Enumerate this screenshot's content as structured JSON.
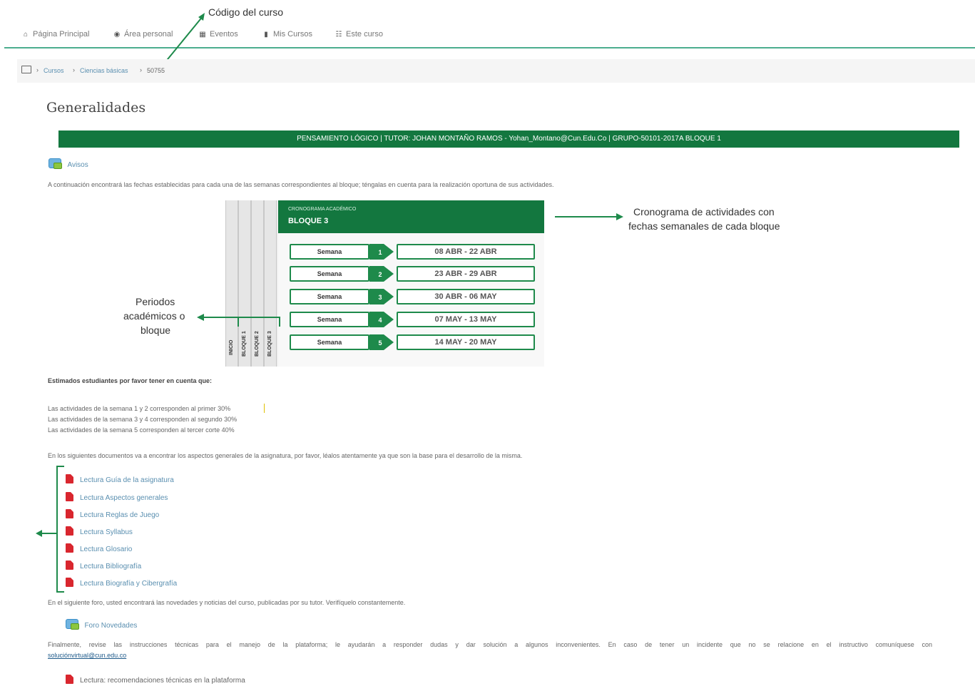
{
  "annotations": {
    "course_code": "Código del curso",
    "schedule_line1": "Cronograma de actividades con",
    "schedule_line2": "fechas semanales de cada bloque",
    "periods_line1": "Periodos",
    "periods_line2": "académicos o",
    "periods_line3": "bloque"
  },
  "nav": {
    "items": [
      {
        "label": "Página Principal",
        "icon": "home-icon"
      },
      {
        "label": "Área personal",
        "icon": "dashboard-icon"
      },
      {
        "label": "Eventos",
        "icon": "calendar-icon"
      },
      {
        "label": "Mis Cursos",
        "icon": "briefcase-icon"
      },
      {
        "label": "Este curso",
        "icon": "sitemap-icon"
      }
    ]
  },
  "breadcrumb": {
    "items": [
      "Cursos",
      "Ciencias básicas",
      "50755"
    ],
    "separator": "›"
  },
  "page": {
    "title": "Generalidades",
    "banner": "PENSAMIENTO LÓGICO | TUTOR: JOHAN MONTAÑO RAMOS - Yohan_Montano@Cun.Edu.Co | GRUPO-50101-2017A BLOQUE 1",
    "avisos_label": "Avisos",
    "intro": "A continuación encontrará las fechas establecidas para cada una de las semanas correspondientes al bloque; téngalas en cuenta para la realización oportuna de sus actividades."
  },
  "schedule": {
    "header_small": "CRONOGRAMA ACADÉMICO",
    "header_title": "BLOQUE 3",
    "side_labels": [
      "INICIO",
      "BLOQUE 1",
      "BLOQUE 2",
      "BLOQUE 3"
    ],
    "weeks": [
      {
        "label": "Semana",
        "num": "1",
        "dates": "08 ABR - 22 ABR"
      },
      {
        "label": "Semana",
        "num": "2",
        "dates": "23 ABR - 29 ABR"
      },
      {
        "label": "Semana",
        "num": "3",
        "dates": "30 ABR - 06 MAY"
      },
      {
        "label": "Semana",
        "num": "4",
        "dates": "07 MAY - 13 MAY"
      },
      {
        "label": "Semana",
        "num": "5",
        "dates": "14 MAY - 20 MAY"
      }
    ]
  },
  "notes": {
    "heading": "Estimados estudiantes por favor tener en cuenta que:",
    "lines": [
      "Las actividades de la semana 1 y 2 corresponden al primer 30%",
      "Las actividades de la semana 3 y 4 corresponden al segundo 30%",
      "Las actividades de la semana 5 corresponden al tercer corte 40%"
    ],
    "docs_intro": "En los siguientes documentos va a encontrar los aspectos generales de la asignatura, por favor, léalos atentamente ya que son la base para el desarrollo de la misma."
  },
  "documents": [
    "Lectura Guía de la asignatura",
    "Lectura Aspectos generales",
    "Lectura Reglas de Juego",
    "Lectura Syllabus",
    "Lectura Glosario",
    "Lectura Bibliografía",
    "Lectura Biografía y Cibergrafía"
  ],
  "forum": {
    "intro": "En el siguiente foro, usted encontrará las novedades y noticias del curso, publicadas por su tutor. Verifíquelo constantemente.",
    "label": "Foro Novedades"
  },
  "final": {
    "text": "Finalmente, revise las instrucciones técnicas para el manejo de la plataforma; le ayudarán a responder dudas y dar solución a algunos inconvenientes. En caso de tener un incidente que no se relacione en el instructivo comuníquese con",
    "email": "soluciónvirtual@cun.edu.co",
    "last_doc": "Lectura: recomendaciones técnicas en la plataforma"
  },
  "colors": {
    "green": "#1e8a4b",
    "banner": "#13773f",
    "link": "#5a8fb0",
    "pdf": "#d9262e"
  }
}
